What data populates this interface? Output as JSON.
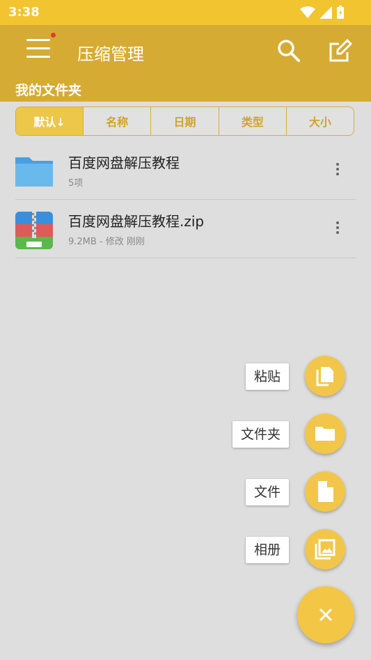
{
  "status_bar": {
    "time": "3:38"
  },
  "app_bar": {
    "title": "压缩管理",
    "section_title": "我的文件夹"
  },
  "sort_tabs": [
    {
      "label": "默认↓"
    },
    {
      "label": "名称"
    },
    {
      "label": "日期"
    },
    {
      "label": "类型"
    },
    {
      "label": "大小"
    }
  ],
  "files": [
    {
      "name": "百度网盘解压教程",
      "meta": "5项",
      "icon": "folder-icon"
    },
    {
      "name": "百度网盘解压教程.zip",
      "meta": "9.2MB - 修改 刚刚",
      "icon": "zip-archive-icon"
    }
  ],
  "fab_menu": [
    {
      "label": "粘贴",
      "icon": "paste-icon"
    },
    {
      "label": "文件夹",
      "icon": "folder-icon"
    },
    {
      "label": "文件",
      "icon": "file-icon"
    },
    {
      "label": "相册",
      "icon": "photo-library-icon"
    }
  ],
  "fab_close_icon": "close-icon",
  "colors": {
    "accent": "#f2c430",
    "appbar": "#d5ab33",
    "background": "#dedede"
  }
}
